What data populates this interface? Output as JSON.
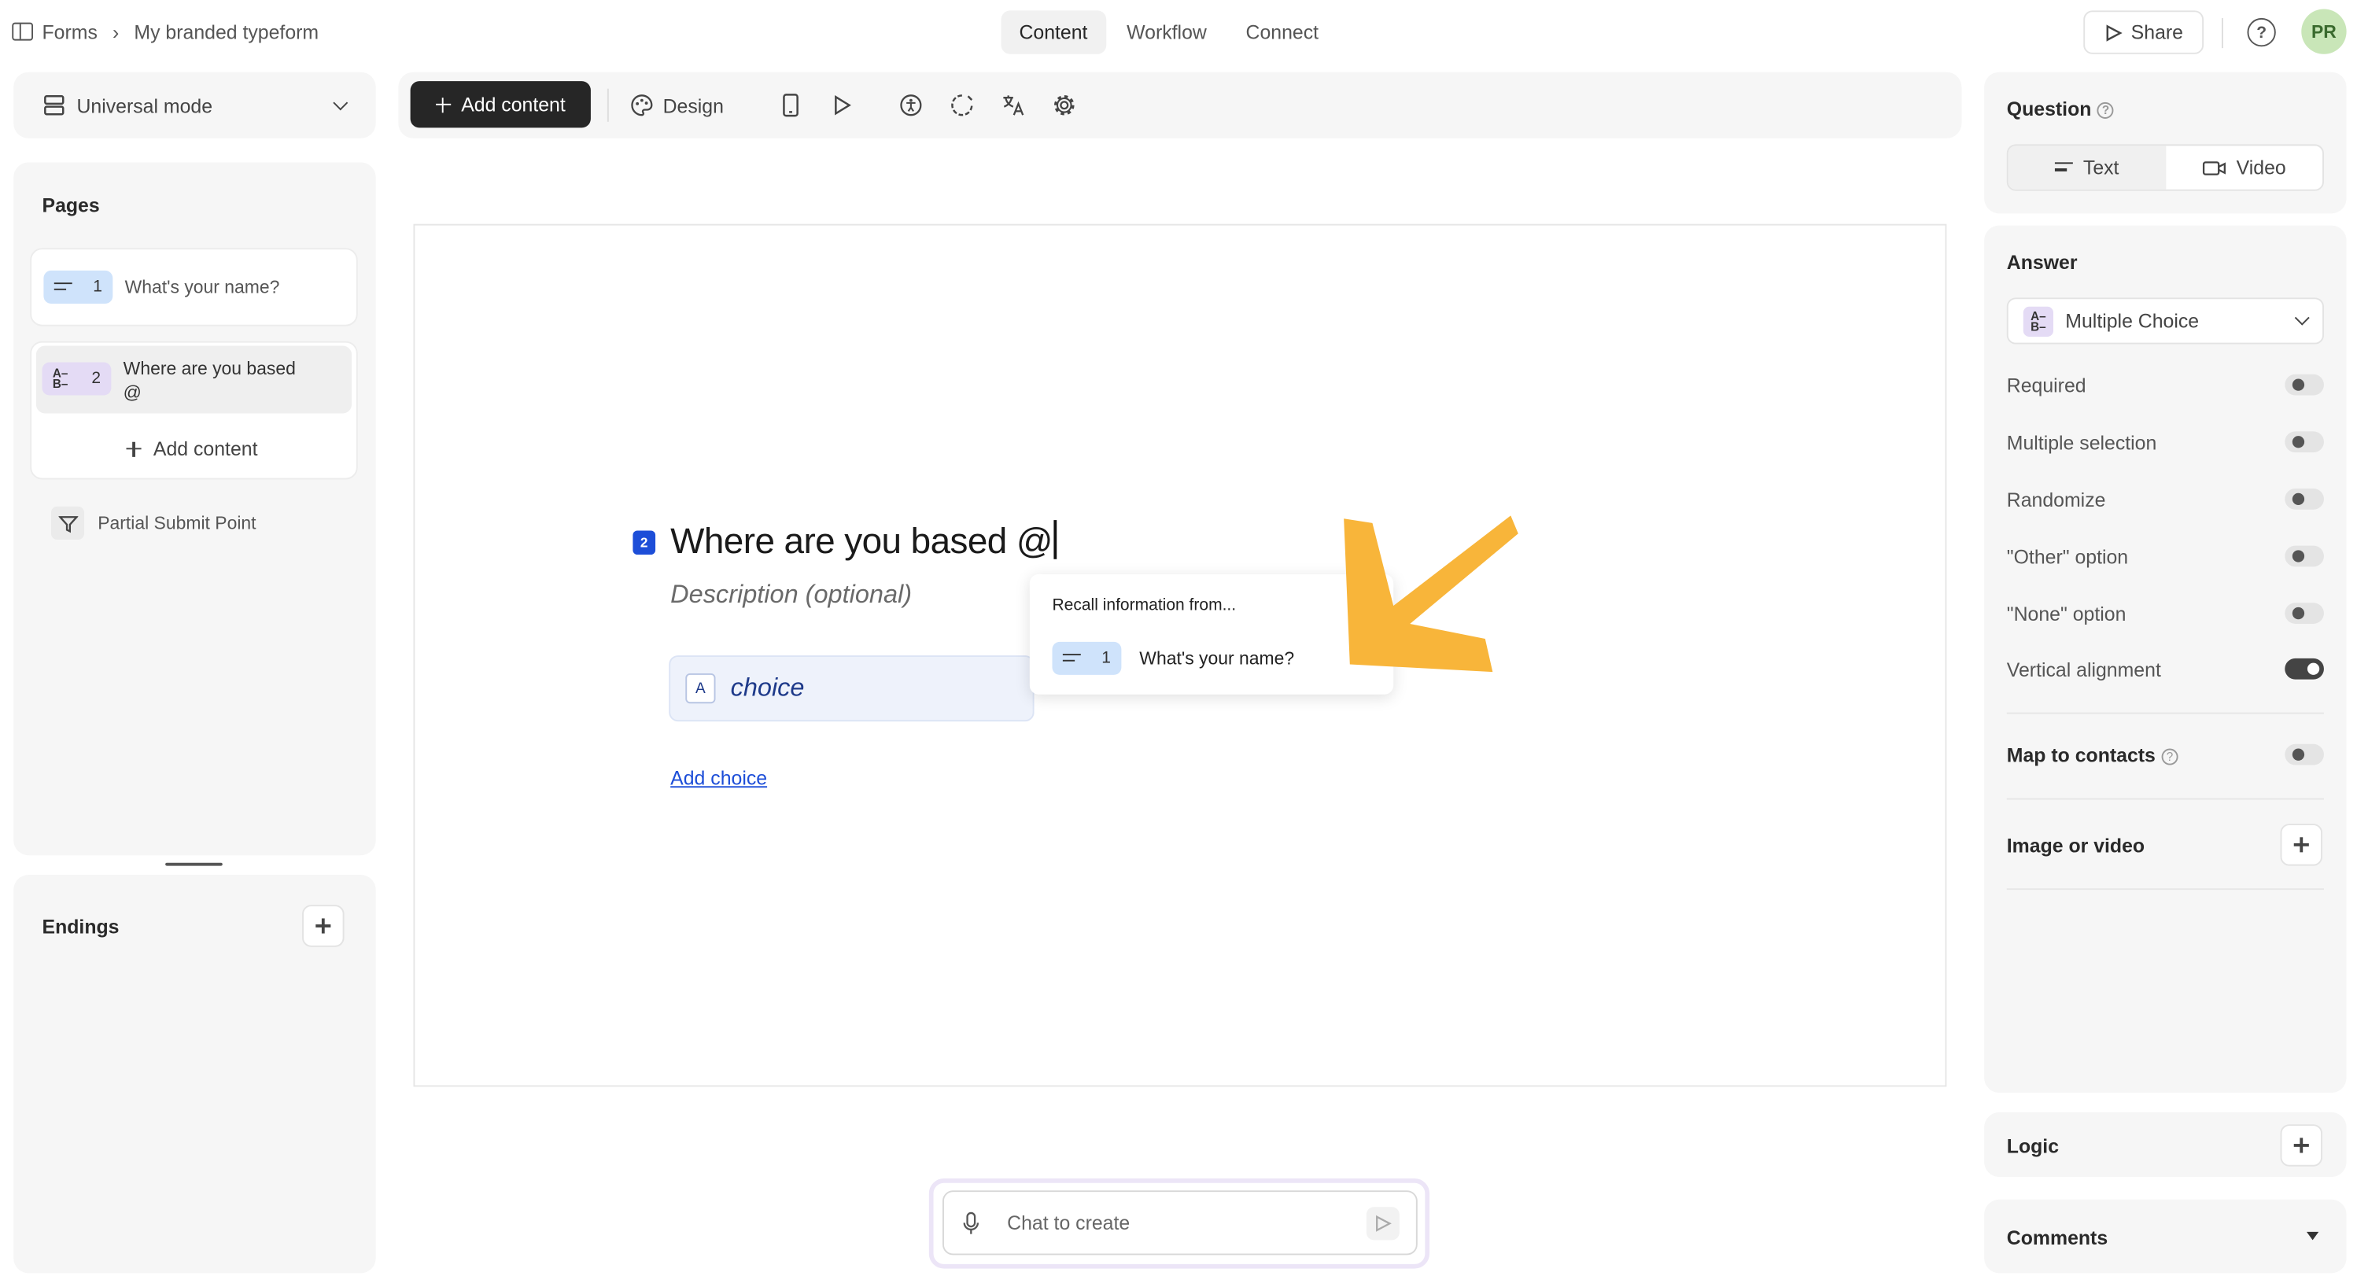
{
  "breadcrumb": {
    "root": "Forms",
    "separator": "›",
    "current": "My branded typeform"
  },
  "top_tabs": [
    "Content",
    "Workflow",
    "Connect"
  ],
  "active_tab": "Content",
  "share_label": "Share",
  "help_label": "?",
  "avatar_initials": "PR",
  "mode": {
    "label": "Universal mode"
  },
  "pages": {
    "title": "Pages",
    "items": [
      {
        "number": "1",
        "label": "What's your name?",
        "type_icon": "short-text-icon"
      },
      {
        "number": "2",
        "label": "Where are you based",
        "label_line2": "@",
        "type_icon": "multiple-choice-icon"
      }
    ],
    "add_content": "Add content",
    "partial_submit": "Partial Submit Point"
  },
  "endings": {
    "title": "Endings"
  },
  "toolbar": {
    "add_content": "Add content",
    "design": "Design",
    "icons": [
      "mobile-preview-icon",
      "play-icon",
      "accessibility-icon",
      "loading-icon",
      "translate-icon",
      "settings-icon"
    ]
  },
  "question": {
    "number": "2",
    "title": "Where are you based @",
    "description_placeholder": "Description (optional)",
    "choices": [
      {
        "key": "A",
        "label": "choice"
      }
    ],
    "add_choice": "Add choice"
  },
  "recall_popup": {
    "title": "Recall information from...",
    "items": [
      {
        "number": "1",
        "label": "What's your name?"
      }
    ]
  },
  "chat": {
    "placeholder": "Chat to create"
  },
  "right_panel": {
    "question_title": "Question",
    "question_modes": [
      "Text",
      "Video"
    ],
    "active_mode": "Text",
    "answer_title": "Answer",
    "answer_type": "Multiple Choice",
    "settings": [
      {
        "label": "Required",
        "on": false
      },
      {
        "label": "Multiple selection",
        "on": false
      },
      {
        "label": "Randomize",
        "on": false
      },
      {
        "label": "\"Other\" option",
        "on": false
      },
      {
        "label": "\"None\" option",
        "on": false
      },
      {
        "label": "Vertical alignment",
        "on": true
      }
    ],
    "map_to_contacts": {
      "label": "Map to contacts",
      "on": false
    },
    "image_or_video": "Image or video",
    "logic": "Logic",
    "comments": "Comments"
  },
  "colors": {
    "accent_question_number": "#1d4ed8",
    "annotation_arrow": "#f8b53a",
    "primary_button": "#262626"
  }
}
